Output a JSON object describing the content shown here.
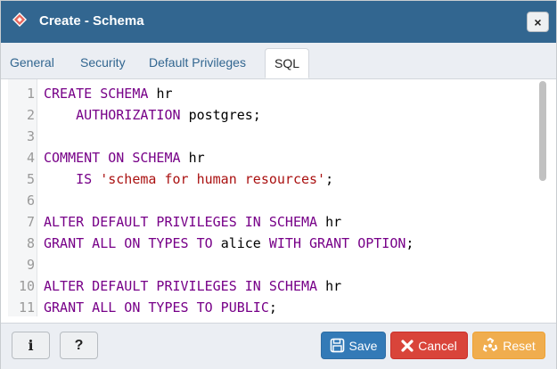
{
  "dialog": {
    "title": "Create - Schema",
    "close_label": "×"
  },
  "tabs": [
    {
      "label": "General",
      "active": false
    },
    {
      "label": "Security",
      "active": false
    },
    {
      "label": "Default Privileges",
      "active": false
    },
    {
      "label": "SQL",
      "active": true
    }
  ],
  "sql_lines": [
    {
      "n": "1",
      "parts": [
        {
          "t": "CREATE SCHEMA ",
          "c": "kw"
        },
        {
          "t": "hr",
          "c": "ident"
        }
      ]
    },
    {
      "n": "2",
      "parts": [
        {
          "t": "    AUTHORIZATION ",
          "c": "kw"
        },
        {
          "t": "postgres;",
          "c": "ident"
        }
      ]
    },
    {
      "n": "3",
      "parts": []
    },
    {
      "n": "4",
      "parts": [
        {
          "t": "COMMENT ON SCHEMA ",
          "c": "kw"
        },
        {
          "t": "hr",
          "c": "ident"
        }
      ]
    },
    {
      "n": "5",
      "parts": [
        {
          "t": "    IS ",
          "c": "kw"
        },
        {
          "t": "'schema for human resources'",
          "c": "str"
        },
        {
          "t": ";",
          "c": "ident"
        }
      ]
    },
    {
      "n": "6",
      "parts": []
    },
    {
      "n": "7",
      "parts": [
        {
          "t": "ALTER DEFAULT PRIVILEGES IN SCHEMA ",
          "c": "kw"
        },
        {
          "t": "hr",
          "c": "ident"
        }
      ]
    },
    {
      "n": "8",
      "parts": [
        {
          "t": "GRANT ALL ON TYPES TO ",
          "c": "kw"
        },
        {
          "t": "alice ",
          "c": "ident"
        },
        {
          "t": "WITH GRANT OPTION",
          "c": "kw"
        },
        {
          "t": ";",
          "c": "ident"
        }
      ]
    },
    {
      "n": "9",
      "parts": []
    },
    {
      "n": "10",
      "parts": [
        {
          "t": "ALTER DEFAULT PRIVILEGES IN SCHEMA ",
          "c": "kw"
        },
        {
          "t": "hr",
          "c": "ident"
        }
      ]
    },
    {
      "n": "11",
      "parts": [
        {
          "t": "GRANT ALL ON TYPES TO PUBLIC",
          "c": "kw"
        },
        {
          "t": ";",
          "c": "ident"
        }
      ]
    }
  ],
  "footer": {
    "info_label": "i",
    "help_label": "?",
    "save_label": "Save",
    "cancel_label": "Cancel",
    "reset_label": "Reset"
  },
  "colors": {
    "title_bar": "#326690",
    "save": "#337ab7",
    "cancel": "#d9443a",
    "reset": "#f0ad4e",
    "keyword": "#770088",
    "string": "#aa1111"
  },
  "icons": {
    "title": "schema-diamond-icon",
    "close": "close-icon",
    "save": "floppy-disk-icon",
    "cancel": "x-mark-icon",
    "reset": "recycle-icon"
  }
}
